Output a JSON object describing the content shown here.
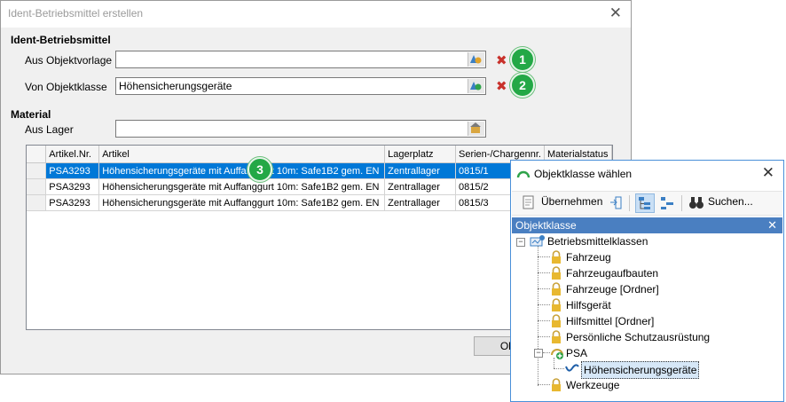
{
  "dialog": {
    "title": "Ident-Betriebsmittel erstellen",
    "section_ident": "Ident-Betriebsmittel",
    "label_objektvorlage": "Aus Objektvorlage",
    "value_objektvorlage": "",
    "label_objektklasse": "Von Objektklasse",
    "value_objektklasse": "Höhensicherungsgeräte",
    "section_material": "Material",
    "label_lager": "Aus Lager",
    "value_lager": "",
    "ok_label": "Ok",
    "badges": [
      "1",
      "2",
      "3"
    ]
  },
  "grid": {
    "columns": [
      "Artikel.Nr.",
      "Artikel",
      "Lagerplatz",
      "Serien-/Chargennr.",
      "Materialstatus"
    ],
    "rows": [
      [
        "PSA3293",
        "Höhensicherungsgeräte mit Auffanggurt 10m: Safe1B2 gem. EN",
        "Zentrallager",
        "0815/1",
        ""
      ],
      [
        "PSA3293",
        "Höhensicherungsgeräte mit Auffanggurt 10m: Safe1B2 gem. EN",
        "Zentrallager",
        "0815/2",
        ""
      ],
      [
        "PSA3293",
        "Höhensicherungsgeräte mit Auffanggurt 10m: Safe1B2 gem. EN",
        "Zentrallager",
        "0815/3",
        ""
      ]
    ],
    "selected_row": 0
  },
  "popup": {
    "title": "Objektklasse wählen",
    "toolbar": {
      "apply_label": "Übernehmen",
      "search_label": "Suchen..."
    },
    "pane_title": "Objektklasse",
    "tree": {
      "root": "Betriebsmittelklassen",
      "items": [
        "Fahrzeug",
        "Fahrzeugaufbauten",
        "Fahrzeuge [Ordner]",
        "Hilfsgerät",
        "Hilfsmittel [Ordner]",
        "Persönliche Schutzausrüstung",
        "PSA",
        "Höhensicherungsgeräte",
        "Werkzeuge"
      ]
    }
  },
  "colors": {
    "accent": "#0078d7",
    "badge": "#23a846",
    "clear": "#c8312b",
    "pane_header": "#4a7fc1"
  }
}
